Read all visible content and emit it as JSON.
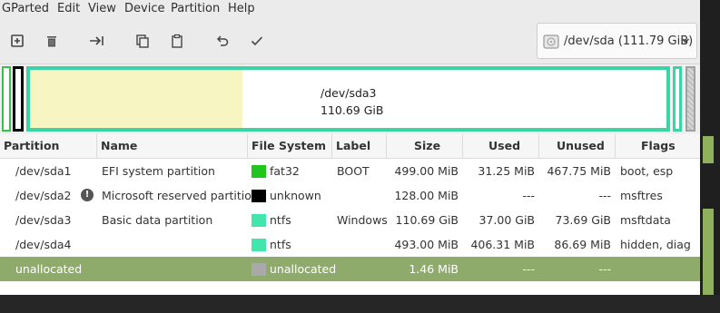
{
  "menubar": {
    "items": [
      "GParted",
      "Edit",
      "View",
      "Device",
      "Partition",
      "Help"
    ]
  },
  "toolbar": {
    "buttons": [
      "new-partition-icon",
      "delete-icon",
      "resize-move-icon",
      "copy-icon",
      "paste-icon",
      "undo-icon",
      "apply-icon"
    ]
  },
  "device_selector": {
    "label": "/dev/sda   (111.79 GiB)"
  },
  "partition_bar": {
    "sda3_name": "/dev/sda3",
    "sda3_size": "110.69 GiB",
    "sda3_used_fraction": 0.334
  },
  "table": {
    "columns": [
      "Partition",
      "Name",
      "File System",
      "Label",
      "Size",
      "Used",
      "Unused",
      "Flags"
    ],
    "rows": [
      {
        "partition": "/dev/sda1",
        "name": "EFI system partition",
        "fs": "fat32",
        "fs_color": "#1ec61e",
        "label": "BOOT",
        "size": "499.00 MiB",
        "used": "31.25 MiB",
        "unused": "467.75 MiB",
        "flags": "boot, esp",
        "warning": false
      },
      {
        "partition": "/dev/sda2",
        "name": "Microsoft reserved partition",
        "fs": "unknown",
        "fs_color": "#000000",
        "label": "",
        "size": "128.00 MiB",
        "used": "---",
        "unused": "---",
        "flags": "msftres",
        "warning": true
      },
      {
        "partition": "/dev/sda3",
        "name": "Basic data partition",
        "fs": "ntfs",
        "fs_color": "#42e5ac",
        "label": "Windows",
        "size": "110.69 GiB",
        "used": "37.00 GiB",
        "unused": "73.69 GiB",
        "flags": "msftdata",
        "warning": false
      },
      {
        "partition": "/dev/sda4",
        "name": "",
        "fs": "ntfs",
        "fs_color": "#42e5ac",
        "label": "",
        "size": "493.00 MiB",
        "used": "406.31 MiB",
        "unused": "86.69 MiB",
        "flags": "hidden, diag",
        "warning": false
      },
      {
        "partition": "unallocated",
        "name": "",
        "fs": "unallocated",
        "fs_color": "#a9a9a9",
        "label": "",
        "size": "1.46 MiB",
        "used": "---",
        "unused": "---",
        "flags": "",
        "warning": false,
        "selected": true
      }
    ]
  }
}
